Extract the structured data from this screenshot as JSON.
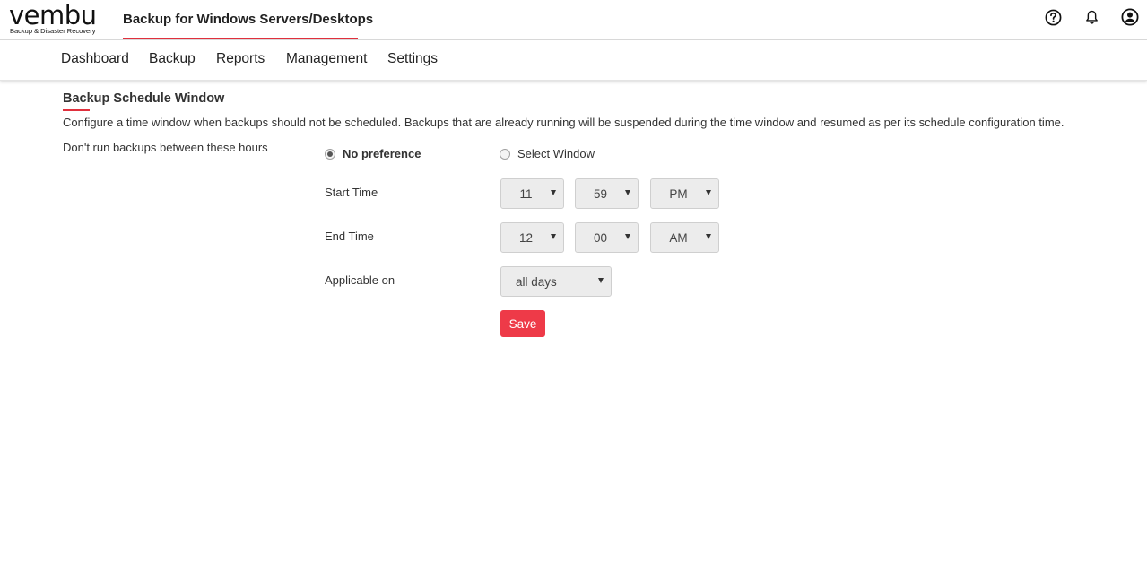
{
  "brand": {
    "logo_text": "vembu",
    "logo_tagline": "Backup & Disaster Recovery",
    "app_title": "Backup for Windows Servers/Desktops",
    "accent_color": "#e0303d"
  },
  "header_icons": [
    "help-icon",
    "bell-icon",
    "user-account-icon"
  ],
  "nav": {
    "items": [
      "Dashboard",
      "Backup",
      "Reports",
      "Management",
      "Settings"
    ]
  },
  "page": {
    "title": "Backup Schedule Window",
    "description": "Configure a time window when backups should not be scheduled. Backups that are already running will be suspended during the time window and resumed as per its schedule configuration time.",
    "row_label": "Don't run backups between these hours"
  },
  "options": {
    "no_preference": "No preference",
    "select_window": "Select Window",
    "selected": "No preference"
  },
  "form": {
    "start_time_label": "Start Time",
    "start_time": {
      "hour": "11",
      "minute": "59",
      "ampm": "PM"
    },
    "end_time_label": "End Time",
    "end_time": {
      "hour": "12",
      "minute": "00",
      "ampm": "AM"
    },
    "applicable_label": "Applicable on",
    "applicable_value": "all days",
    "save_label": "Save"
  }
}
